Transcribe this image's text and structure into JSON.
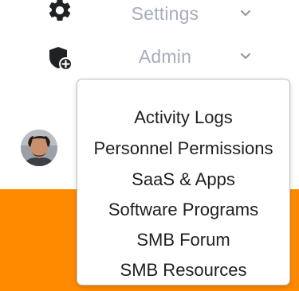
{
  "nav": {
    "settings": {
      "label": "Settings",
      "icon": "gear-icon",
      "chevron": "chevron-down-icon"
    },
    "admin": {
      "label": "Admin",
      "icon": "shield-plus-icon",
      "chevron": "chevron-down-icon"
    }
  },
  "user": {
    "avatar": "avatar"
  },
  "dropdown": {
    "items": [
      {
        "label": "Activity Logs"
      },
      {
        "label": "Personnel Permissions"
      },
      {
        "label": "SaaS & Apps"
      },
      {
        "label": "Software Programs"
      },
      {
        "label": "SMB Forum"
      },
      {
        "label": "SMB Resources"
      }
    ]
  },
  "colors": {
    "accent": "#ff8a00",
    "nav_text": "#a7adbd",
    "icon": "#1f2125",
    "menu_text": "#1f1f1f"
  }
}
